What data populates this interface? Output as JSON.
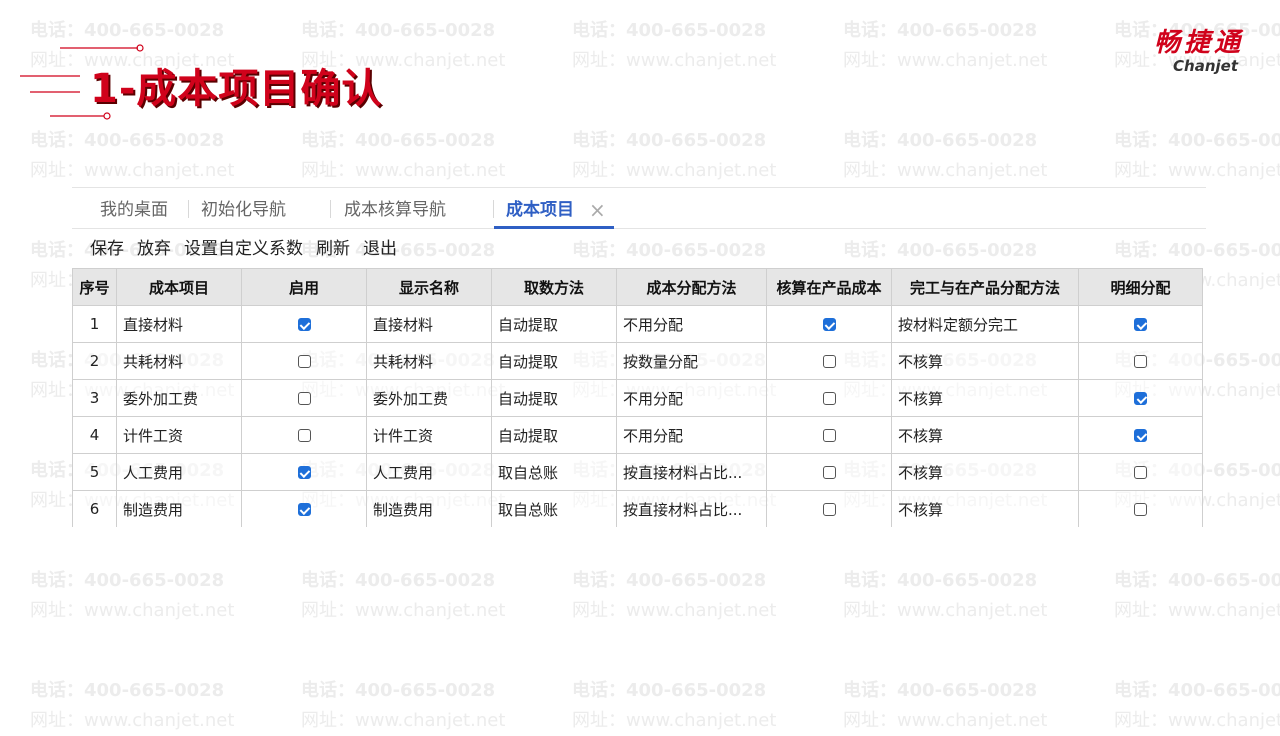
{
  "slide": {
    "title": "1-成本项目确认"
  },
  "logo": {
    "cn": "畅捷通",
    "en": "Chanjet"
  },
  "watermark": {
    "phone": "电话：400-665-0028",
    "site": "网址：www.chanjet.net"
  },
  "tabs": [
    {
      "label": "我的桌面",
      "active": false
    },
    {
      "label": "初始化导航",
      "active": false
    },
    {
      "label": "成本核算导航",
      "active": false
    },
    {
      "label": "成本项目",
      "active": true
    }
  ],
  "tab_close_glyph": "×",
  "toolbar": {
    "save": "保存",
    "discard": "放弃",
    "custom_coef": "设置自定义系数",
    "refresh": "刷新",
    "exit": "退出"
  },
  "table": {
    "headers": [
      "序号",
      "成本项目",
      "启用",
      "显示名称",
      "取数方法",
      "成本分配方法",
      "核算在产品成本",
      "完工与在产品分配方法",
      "明细分配"
    ],
    "rows": [
      {
        "no": "1",
        "item": "直接材料",
        "enabled": true,
        "display": "直接材料",
        "fetch": "自动提取",
        "alloc": "不用分配",
        "wip": true,
        "wip_method": "按材料定额分完工",
        "detail": true
      },
      {
        "no": "2",
        "item": "共耗材料",
        "enabled": false,
        "display": "共耗材料",
        "fetch": "自动提取",
        "alloc": "按数量分配",
        "wip": false,
        "wip_method": "不核算",
        "detail": false
      },
      {
        "no": "3",
        "item": "委外加工费",
        "enabled": false,
        "display": "委外加工费",
        "fetch": "自动提取",
        "alloc": "不用分配",
        "wip": false,
        "wip_method": "不核算",
        "detail": true
      },
      {
        "no": "4",
        "item": "计件工资",
        "enabled": false,
        "display": "计件工资",
        "fetch": "自动提取",
        "alloc": "不用分配",
        "wip": false,
        "wip_method": "不核算",
        "detail": true
      },
      {
        "no": "5",
        "item": "人工费用",
        "enabled": true,
        "display": "人工费用",
        "fetch": "取自总账",
        "alloc": "按直接材料占比...",
        "wip": false,
        "wip_method": "不核算",
        "detail": false
      },
      {
        "no": "6",
        "item": "制造费用",
        "enabled": true,
        "display": "制造费用",
        "fetch": "取自总账",
        "alloc": "按直接材料占比...",
        "wip": false,
        "wip_method": "不核算",
        "detail": false
      }
    ]
  },
  "colors": {
    "title_red": "#d0021b",
    "accent_blue": "#2f5fc4",
    "checkbox_blue": "#1e6fd9",
    "header_gray": "#e6e6e6"
  }
}
